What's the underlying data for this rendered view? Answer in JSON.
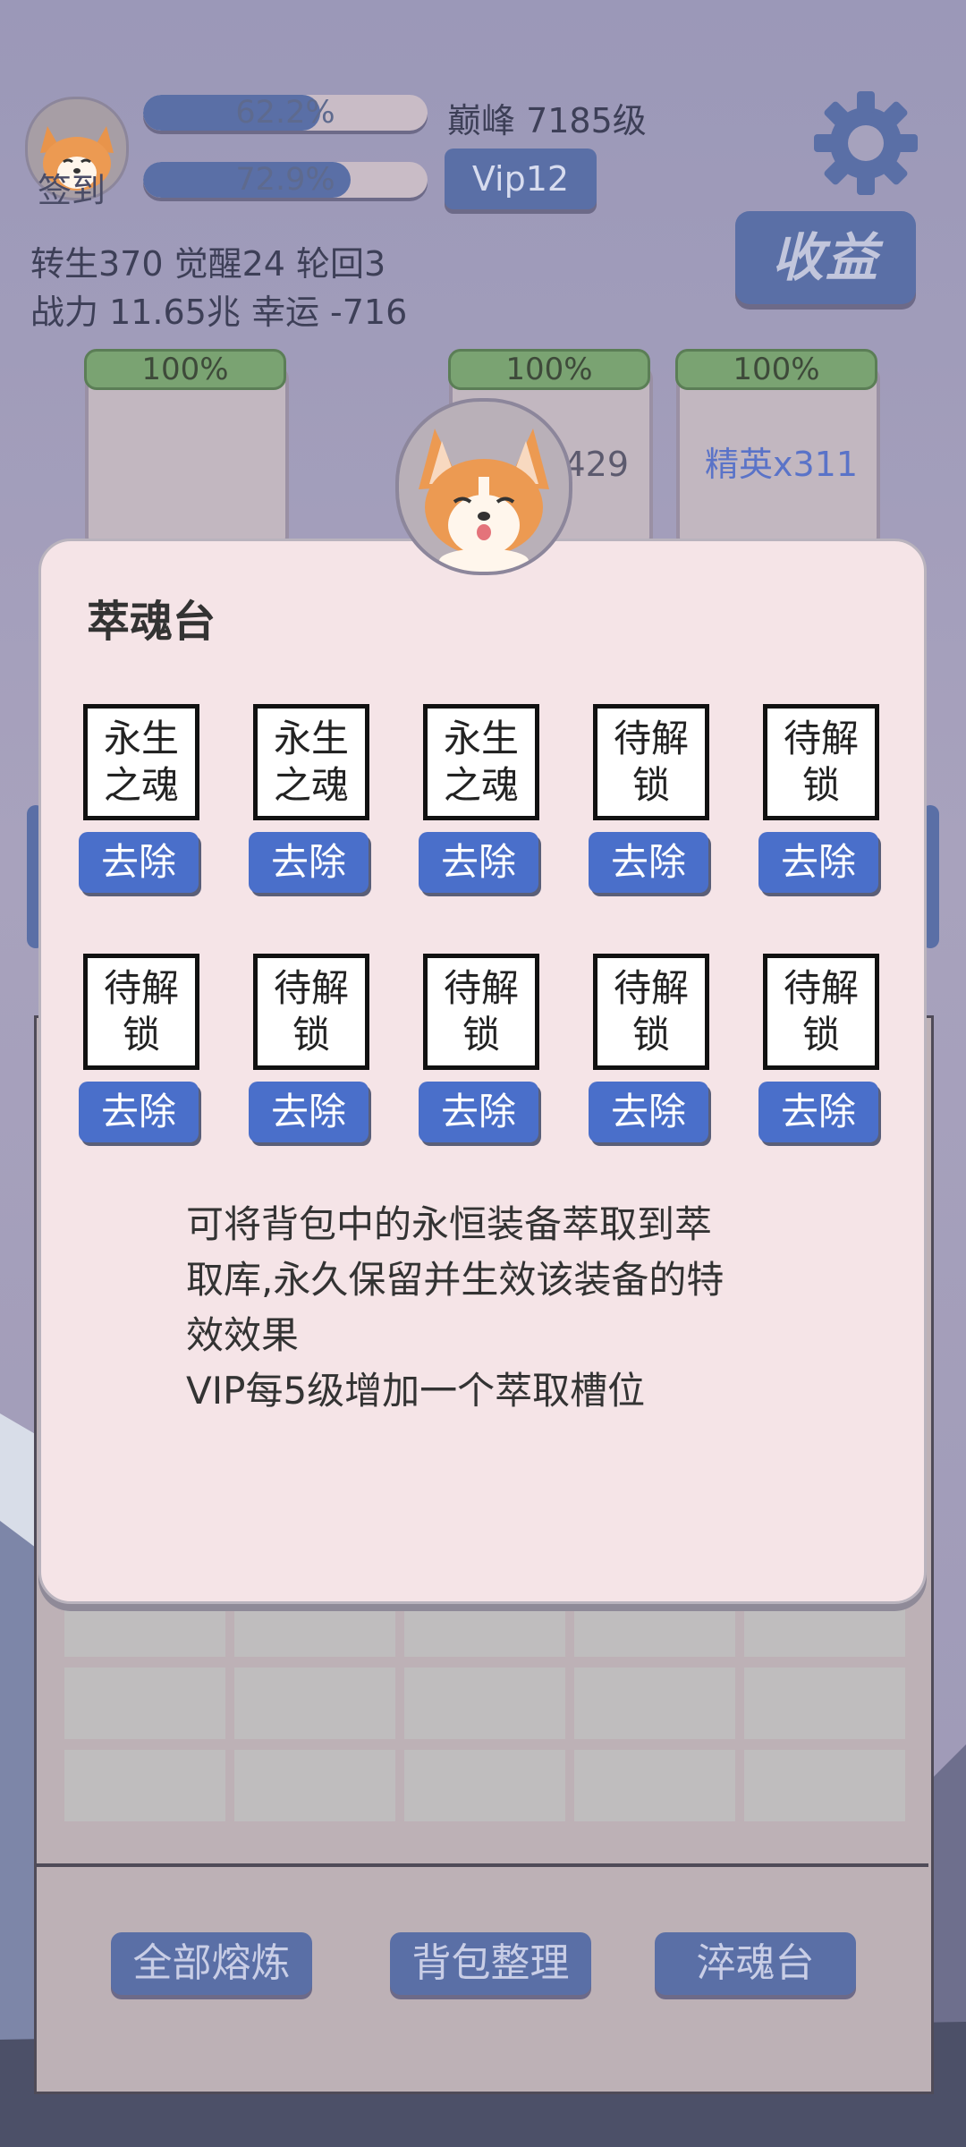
{
  "hud": {
    "signin_label": "签到",
    "exp_bar_1": {
      "value_label": "62.2%",
      "fraction": 0.622
    },
    "exp_bar_2": {
      "value_label": "72.9%",
      "fraction": 0.729
    },
    "peak_level": "巅峰 7185级",
    "vip_label": "Vip12",
    "income_button": "收益",
    "stats_line_1": "转生370 觉醒24 轮回3",
    "stats_line_2": "战力 11.65兆  幸运 -716"
  },
  "cards": [
    {
      "progress_label": "100%",
      "text": ""
    },
    {
      "progress_label": "100%",
      "text": "小怪x429"
    },
    {
      "progress_label": "100%",
      "text": "精英x311"
    }
  ],
  "modal": {
    "title": "萃魂台",
    "slots_row1": [
      "永生之魂",
      "永生之魂",
      "永生之魂",
      "待解锁",
      "待解锁"
    ],
    "slots_row2": [
      "待解锁",
      "待解锁",
      "待解锁",
      "待解锁",
      "待解锁"
    ],
    "remove_label": "去除",
    "description_lines": [
      "可将背包中的永恒装备萃取到萃",
      "取库,永久保留并生效该装备的特",
      "效效果",
      "VIP每5级增加一个萃取槽位"
    ]
  },
  "bottom_buttons": {
    "smelt_all": "全部熔炼",
    "sort_bag": "背包整理",
    "soul_altar": "淬魂台"
  },
  "colors": {
    "accent_blue": "#4a6fca",
    "progress_green": "#7aa372",
    "modal_bg": "#f5e4e7",
    "button_muted_blue": "#5a6fa6"
  }
}
